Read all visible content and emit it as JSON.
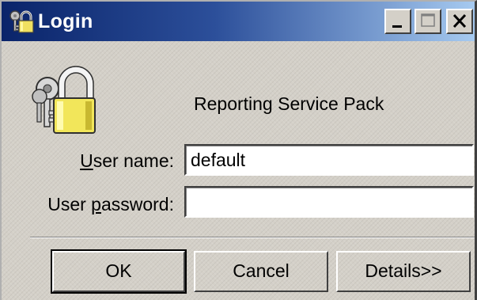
{
  "window": {
    "title": "Login",
    "icon": "keys-lock-icon",
    "controls": [
      "minimize-icon",
      "maximize-icon",
      "close-icon"
    ]
  },
  "dialog": {
    "app_name": "Reporting Service Pack",
    "icon": "lock-with-keys-icon"
  },
  "form": {
    "user_label_mnemonic": "U",
    "user_label_rest": "ser name:",
    "password_label_prefix": "User ",
    "password_label_mnemonic": "p",
    "password_label_rest": "assword:",
    "user_value": "default",
    "password_value": ""
  },
  "buttons": {
    "ok": "OK",
    "cancel": "Cancel",
    "details": "Details>>"
  },
  "colors": {
    "titlebar_start": "#0a246a",
    "titlebar_end": "#a6caf0",
    "face": "#d4d0c8"
  }
}
